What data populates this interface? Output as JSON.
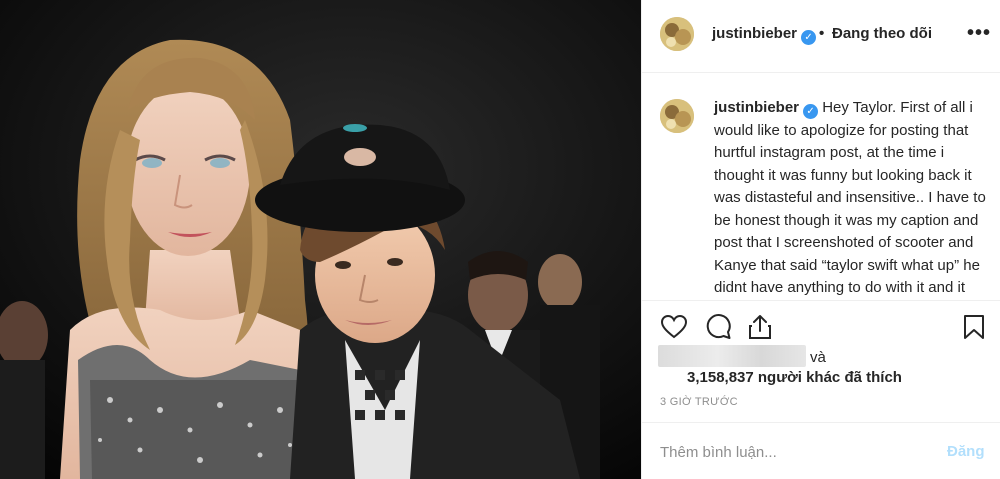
{
  "post": {
    "image_alt": "Photo of two people posing together",
    "header": {
      "username": "justinbieber",
      "dot": "•",
      "follow_label": "Đang theo dõi",
      "more_label": "•••"
    },
    "caption": {
      "username": "justinbieber",
      "text": "Hey Taylor. First of all i would like to apologize for posting that hurtful instagram post, at the time i thought it was funny but looking back it was distasteful and insensitive.. I have to be honest though it was my caption and post that I screenshoted of scooter and Kanye that said “taylor swift what up” he didnt have anything to do with it and it wasnt even a part of the"
    },
    "likes": {
      "and_label": "và",
      "count_text": "3,158,837 người khác đã thích"
    },
    "timestamp": "3 GIỜ TRƯỚC",
    "add_comment": {
      "placeholder": "Thêm bình luận...",
      "post_label": "Đăng"
    }
  },
  "icons": [
    "heart-icon",
    "comment-icon",
    "share-icon",
    "bookmark-icon",
    "verified-icon",
    "more-icon"
  ],
  "colors": {
    "verified": "#3897f0",
    "post_button_disabled": "#b2dffc",
    "secondary_text": "#8e8e8e",
    "border": "#efefef"
  }
}
